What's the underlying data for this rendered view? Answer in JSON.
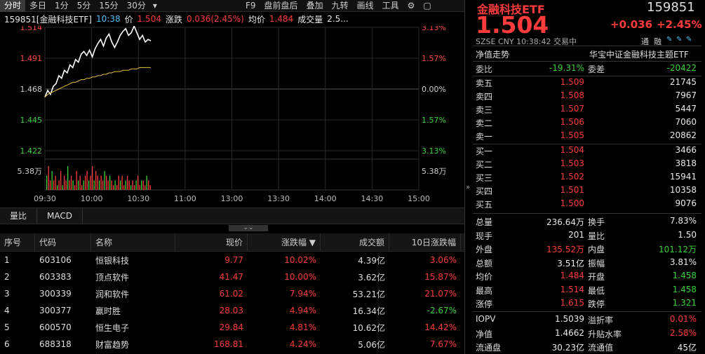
{
  "toolbar": {
    "left": [
      "分时",
      "多日",
      "1分",
      "5分",
      "15分",
      "30分"
    ],
    "right": [
      "F9",
      "盘前盘后",
      "叠加",
      "九转",
      "画线",
      "工具"
    ],
    "settings_icon": "gear-icon",
    "layout_icon": "window-icon"
  },
  "info": {
    "code_name": "159851[金融科技ETF]",
    "time": "10:38",
    "price_label": "价",
    "price": "1.504",
    "change_label": "涨跌",
    "change": "0.036(2.45%)",
    "avg_label": "均价",
    "avg": "1.484",
    "volume_label": "成交量",
    "volume": "2.5..."
  },
  "chart_data": {
    "type": "line",
    "x_ticks": [
      "09:30",
      "10:00",
      "10:30",
      "11:00",
      "13:00",
      "13:30",
      "14:00",
      "14:30",
      "15:00"
    ],
    "y_left": [
      "1.514",
      "1.491",
      "1.468",
      "1.445",
      "1.422"
    ],
    "y_right": [
      "3.13%",
      "1.57%",
      "0.00%",
      "1.57%",
      "3.13%"
    ],
    "vol_label": "5.38万",
    "ylim": [
      1.422,
      1.514
    ],
    "series": [
      {
        "values": [
          1.462,
          1.467,
          1.464,
          1.47,
          1.472,
          1.478,
          1.476,
          1.482,
          1.48,
          1.486,
          1.484,
          1.49,
          1.488,
          1.494,
          1.496,
          1.493,
          1.497,
          1.492,
          1.498,
          1.502,
          1.505,
          1.5,
          1.506,
          1.509,
          1.503,
          1.499,
          1.503,
          1.508,
          1.511,
          1.513,
          1.508,
          1.51,
          1.515,
          1.51,
          1.505,
          1.508,
          1.503,
          1.505,
          1.504
        ]
      },
      {
        "values": [
          1.462,
          1.464,
          1.465,
          1.466,
          1.467,
          1.468,
          1.469,
          1.47,
          1.471,
          1.472,
          1.473,
          1.473,
          1.474,
          1.475,
          1.475,
          1.476,
          1.476,
          1.477,
          1.477,
          1.478,
          1.478,
          1.479,
          1.479,
          1.48,
          1.48,
          1.481,
          1.481,
          1.481,
          1.482,
          1.482,
          1.482,
          1.483,
          1.483,
          1.483,
          1.484,
          1.484,
          1.484,
          1.484,
          1.484
        ]
      }
    ],
    "volume": [
      3,
      5,
      2,
      4,
      2,
      3,
      1,
      2,
      4,
      1,
      3,
      2,
      5,
      2,
      3,
      2,
      1,
      4,
      2,
      3,
      1,
      2,
      3,
      4,
      2,
      3,
      5,
      2,
      4,
      3,
      2,
      3,
      2,
      4,
      3,
      2,
      3,
      2,
      1,
      2,
      1,
      3,
      2,
      3,
      1,
      2,
      3,
      2,
      1,
      2,
      1,
      2,
      3,
      1,
      2,
      2,
      1,
      3,
      2,
      1
    ]
  },
  "tabs": [
    "量比",
    "MACD"
  ],
  "table": {
    "headers": [
      "序号",
      "代码",
      "名称",
      "现价",
      "涨跌幅 ▼",
      "成交额",
      "10日涨跌幅"
    ],
    "rows": [
      [
        "1",
        "603106",
        "恒银科技",
        "9.77",
        "10.02%",
        "4.39亿",
        "3.06%"
      ],
      [
        "2",
        "603383",
        "顶点软件",
        "41.47",
        "10.00%",
        "3.62亿",
        "15.87%"
      ],
      [
        "3",
        "300339",
        "润和软件",
        "61.02",
        "7.94%",
        "53.21亿",
        "21.07%"
      ],
      [
        "4",
        "300377",
        "赢时胜",
        "28.03",
        "4.94%",
        "16.34亿",
        "-2.67%"
      ],
      [
        "5",
        "600570",
        "恒生电子",
        "29.84",
        "4.81%",
        "10.62亿",
        "14.42%"
      ],
      [
        "6",
        "688318",
        "财富趋势",
        "168.81",
        "4.24%",
        "5.06亿",
        "7.67%"
      ]
    ]
  },
  "right": {
    "title": "金融科技ETF",
    "code": "159851",
    "price": "1.504",
    "change": "+0.036",
    "pct": "+2.45%",
    "market": "SZSE",
    "currency": "CNY",
    "time": "10:38:42",
    "status": "交易中",
    "tags": [
      "通",
      "融"
    ],
    "nav_label": "净值走势",
    "index_name": "华宝中证金融科技主题ETF",
    "weibi_label": "委比",
    "weibi": "-19.31%",
    "weicha_label": "委差",
    "weicha": "-20422",
    "asks": [
      [
        "卖五",
        "1.509",
        "21745"
      ],
      [
        "卖四",
        "1.508",
        "7967"
      ],
      [
        "卖三",
        "1.507",
        "5447"
      ],
      [
        "卖二",
        "1.506",
        "7060"
      ],
      [
        "卖一",
        "1.505",
        "20862"
      ]
    ],
    "bids": [
      [
        "买一",
        "1.504",
        "3466"
      ],
      [
        "买二",
        "1.503",
        "3818"
      ],
      [
        "买三",
        "1.502",
        "15941"
      ],
      [
        "买四",
        "1.501",
        "10358"
      ],
      [
        "买五",
        "1.500",
        "9076"
      ]
    ],
    "stats": [
      [
        "总量",
        "236.64万",
        "换手",
        "7.83%"
      ],
      [
        "现手",
        "201",
        "量比",
        "1.50"
      ],
      [
        "外盘",
        "135.52万",
        "内盘",
        "101.12万"
      ],
      [
        "总额",
        "3.51亿",
        "振幅",
        "3.81%"
      ],
      [
        "均价",
        "1.484",
        "开盘",
        "1.458"
      ],
      [
        "最高",
        "1.514",
        "最低",
        "1.458"
      ],
      [
        "涨停",
        "1.615",
        "跌停",
        "1.321"
      ]
    ],
    "iopv": [
      [
        "IOPV",
        "1.5039",
        "溢折率",
        "0.01%"
      ],
      [
        "净值",
        "1.4662",
        "升贴水率",
        "2.58%"
      ],
      [
        "流通盘",
        "30.23亿",
        "流通值",
        "45亿"
      ]
    ]
  }
}
